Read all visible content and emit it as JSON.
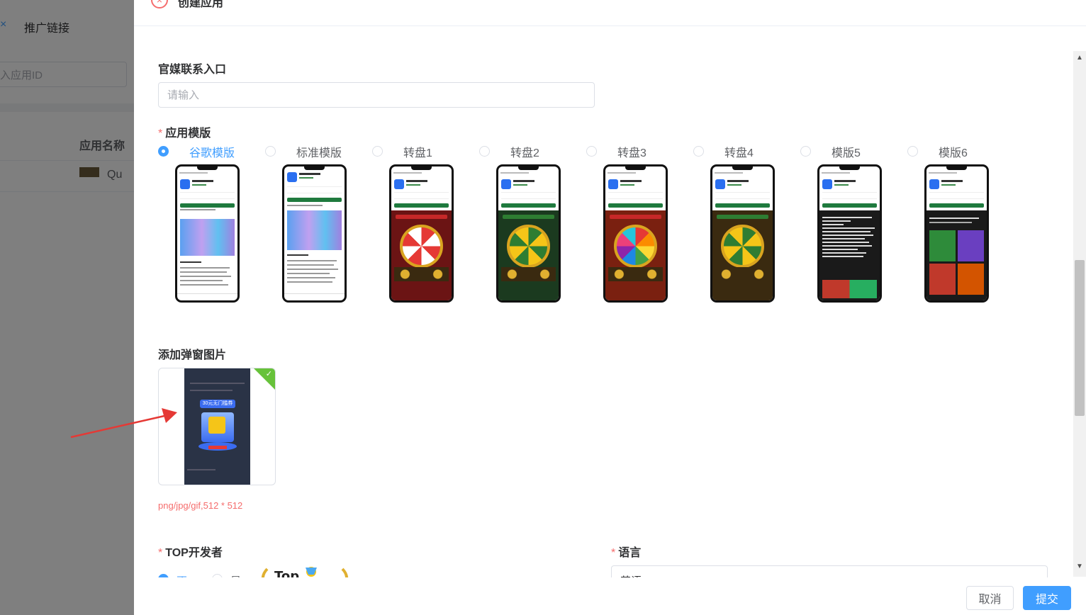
{
  "background": {
    "tab_close": "×",
    "tab_label": "推广链接",
    "search_placeholder": "入应用ID",
    "column_header": "应用名称",
    "row_text": "Qu"
  },
  "drawer": {
    "close_icon": "×",
    "title": "创建应用"
  },
  "form": {
    "contact_label": "官媒联系入口",
    "contact_placeholder": "请输入",
    "template_label": "应用模版",
    "template_required": "*",
    "templates": [
      {
        "label": "谷歌模版",
        "checked": true
      },
      {
        "label": "标准模版",
        "checked": false
      },
      {
        "label": "转盘1",
        "checked": false
      },
      {
        "label": "转盘2",
        "checked": false
      },
      {
        "label": "转盘3",
        "checked": false
      },
      {
        "label": "转盘4",
        "checked": false
      },
      {
        "label": "模版5",
        "checked": false
      },
      {
        "label": "模版6",
        "checked": false
      }
    ],
    "popup_label": "添加弹窗图片",
    "popup_hint": "png/jpg/gif,512 * 512",
    "popup_banner_text": "30元无门槛券",
    "top_dev_label": "TOP开发者",
    "top_dev_required": "*",
    "top_dev_options": [
      "否",
      "是"
    ],
    "top_badge_text": "Top",
    "language_label": "语言",
    "language_required": "*",
    "language_value": "英语"
  },
  "template_mini_text": {
    "store": "Google Play",
    "app": "PWA.APP",
    "install": "Loading",
    "domain": "8888888.COM",
    "casino_heading": "NOS INVADIMOS ESTE LUXUOSO CASSINO",
    "welcome": "WELCOME TO PWA.APP"
  },
  "footer": {
    "cancel_label": "取消",
    "submit_label": "提交"
  },
  "colors": {
    "primary": "#409eff",
    "danger": "#f56c6c",
    "success": "#67c23a",
    "arrow": "#e53935"
  }
}
